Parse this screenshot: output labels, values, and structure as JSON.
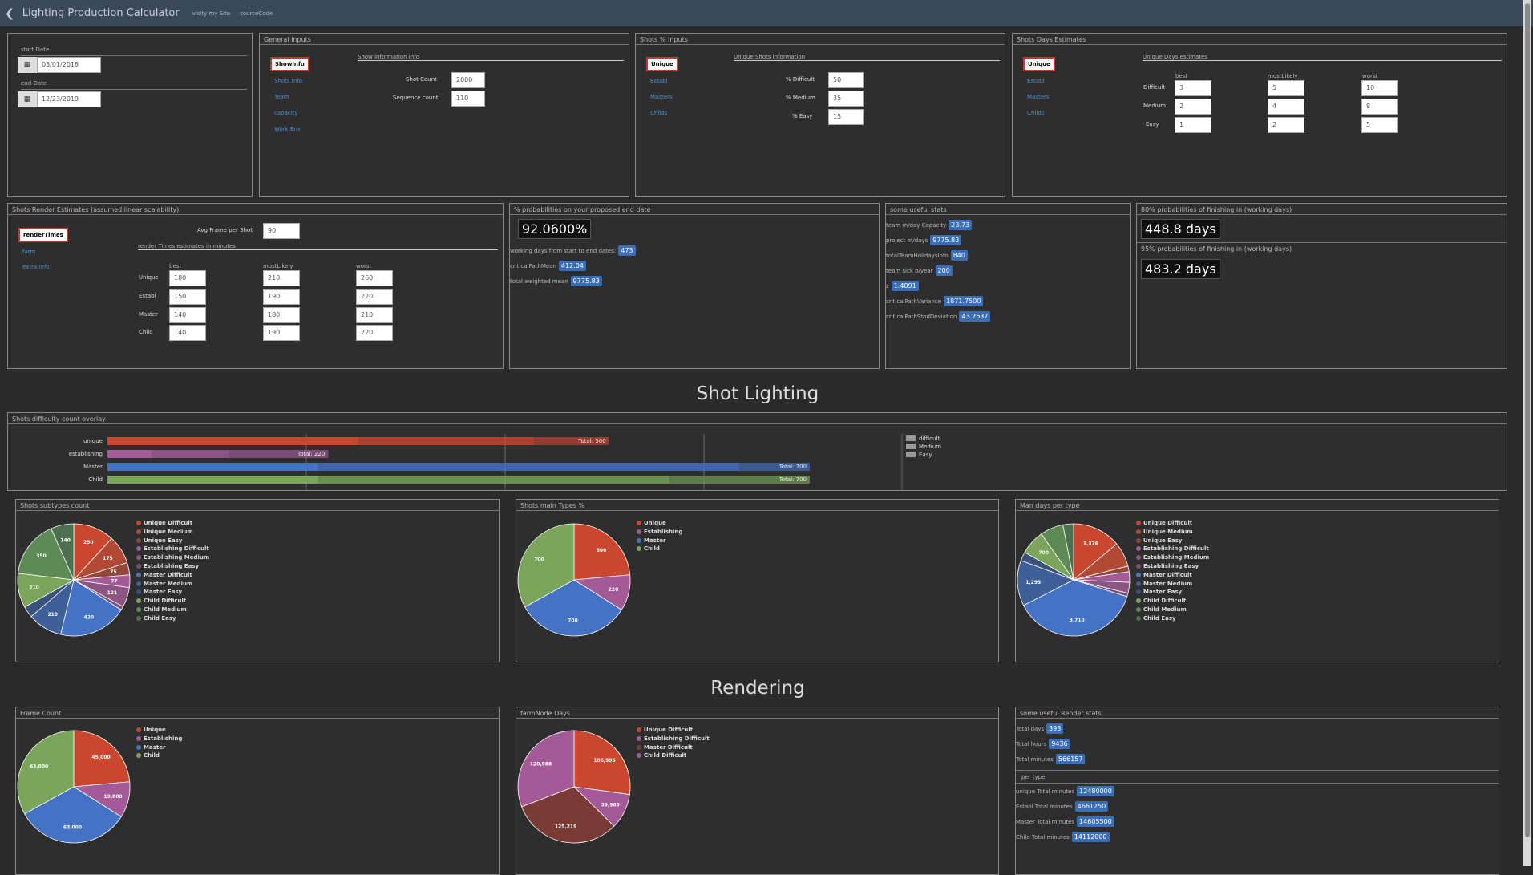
{
  "app": {
    "title": "Lighting Production Calculator",
    "link1": "visity my Site",
    "link2": "sourceCode"
  },
  "dates": {
    "start_label": "start Date",
    "start_value": "03/01/2018",
    "end_label": "end Date",
    "end_value": "12/23/2019"
  },
  "general": {
    "title": "General Inputs",
    "btn": "ShowInfo",
    "links": [
      "Shots Info",
      "Team",
      "capacity",
      "Work Env"
    ],
    "info_title": "Show information Info",
    "shot_count_label": "Shot Count",
    "shot_count": "2000",
    "seq_label": "Sequence count",
    "seq_count": "110"
  },
  "shots_pct": {
    "title": "Shots % Inputs",
    "btn": "Unique",
    "links": [
      "Establ",
      "Masters",
      "Childs"
    ],
    "info_title": "Unique Shots information",
    "rows": [
      {
        "label": "% Difficult",
        "value": "50"
      },
      {
        "label": "% Medium",
        "value": "35"
      },
      {
        "label": "% Easy",
        "value": "15"
      }
    ]
  },
  "days_est": {
    "title": "Shots Days Estimates",
    "btn": "Unique",
    "links": [
      "Establ",
      "Masters",
      "Childs"
    ],
    "info_title": "Unique Days estimates",
    "cols": [
      "best",
      "mostLikely",
      "worst"
    ],
    "rows": [
      {
        "label": "Difficult",
        "values": [
          "3",
          "5",
          "10"
        ]
      },
      {
        "label": "Medium",
        "values": [
          "2",
          "4",
          "8"
        ]
      },
      {
        "label": "Easy",
        "values": [
          "1",
          "2",
          "5"
        ]
      }
    ]
  },
  "render_est": {
    "title": "Shots Render Estimates (assumed linear scalability)",
    "btn": "renderTimes",
    "links": [
      "farm",
      "extra Info"
    ],
    "avg_label": "Avg Frame per Shot",
    "avg_value": "90",
    "sub_title": "render Times estimates in minutes",
    "cols": [
      "best",
      "mostLikely",
      "worst"
    ],
    "rows": [
      {
        "label": "Unique",
        "values": [
          "180",
          "210",
          "260"
        ]
      },
      {
        "label": "Establ",
        "values": [
          "150",
          "190",
          "220"
        ]
      },
      {
        "label": "Master",
        "values": [
          "140",
          "180",
          "210"
        ]
      },
      {
        "label": "Child",
        "values": [
          "140",
          "190",
          "220"
        ]
      }
    ]
  },
  "prob": {
    "title": "% probabilities on your proposed end date",
    "value": "92.0600%",
    "rows": [
      {
        "label": "working days from start to end dates:",
        "value": "473"
      },
      {
        "label": "criticalPathMean",
        "value": "412.04"
      },
      {
        "label": "total weighted mean",
        "value": "9775.83"
      }
    ]
  },
  "stats": {
    "title": "some useful stats",
    "rows": [
      {
        "label": "team m/day Capacity",
        "value": "23.73"
      },
      {
        "label": "project m/days",
        "value": "9775.83"
      },
      {
        "label": "totalTeamHolidaysInfo",
        "value": "840"
      },
      {
        "label": "team sick p/year",
        "value": "200"
      },
      {
        "label": "z",
        "value": "1.4091"
      },
      {
        "label": "criticalPathVariance",
        "value": "1871.7500"
      },
      {
        "label": "criticalPathStndDeviation",
        "value": "43.2637"
      }
    ]
  },
  "finish": {
    "title80": "80% probabilities of finishing in (working days)",
    "value80": "448.8 days",
    "title95": "95% probabilities of finishing in (working days)",
    "value95": "483.2 days"
  },
  "section1": "Shot Lighting",
  "section2": "Rendering",
  "overlay": {
    "title": "Shots difficulty count overlay",
    "legend": [
      "difficult",
      "Medium",
      "Easy"
    ],
    "rows": [
      {
        "label": "unique",
        "color": "#c9472f",
        "segments": [
          250,
          175,
          75
        ],
        "total": "Total: 500"
      },
      {
        "label": "establishing",
        "color": "#a55a98",
        "segments": [
          44,
          77,
          99
        ],
        "total": "Total: 220"
      },
      {
        "label": "Master",
        "color": "#4472c4",
        "segments": [
          210,
          420,
          70
        ],
        "total": "Total: 700"
      },
      {
        "label": "Child",
        "color": "#7aa55a",
        "segments": [
          210,
          350,
          140
        ],
        "total": "Total: 700"
      }
    ],
    "max": 700
  },
  "pie1": {
    "title": "Shots subtypes count",
    "legend": [
      "Unique Difficult",
      "Unique Medium",
      "Unique Easy",
      "Establishing Difficult",
      "Establishing Medium",
      "Establishing Easy",
      "Master Difficult",
      "Master Medium",
      "Master Easy",
      "Child Difficult",
      "Child Medium",
      "Child Easy"
    ],
    "colors": [
      "#c9472f",
      "#b04a35",
      "#93463a",
      "#a55a98",
      "#8d5584",
      "#7a4f72",
      "#4472c4",
      "#3e5f98",
      "#3a517a",
      "#7aa55a",
      "#5e8a55",
      "#4d7050"
    ],
    "values": [
      250,
      175,
      75,
      77,
      121,
      22,
      420,
      210,
      70,
      210,
      350,
      140
    ],
    "labels": [
      "250",
      "175",
      "75",
      "77",
      "121",
      "",
      "420",
      "210",
      "",
      "210",
      "350",
      "140"
    ]
  },
  "pie2": {
    "title": "Shots main Types %",
    "legend": [
      "Unique",
      "Establishing",
      "Master",
      "Child"
    ],
    "colors": [
      "#c9472f",
      "#a55a98",
      "#4472c4",
      "#7aa55a"
    ],
    "values": [
      500,
      220,
      700,
      700
    ],
    "labels": [
      "500",
      "220",
      "700",
      "700"
    ]
  },
  "pie3": {
    "title": "Man days per type",
    "legend": [
      "Unique Difficult",
      "Unique Medium",
      "Unique Easy",
      "Establishing Difficult",
      "Establishing Medium",
      "Establishing Easy",
      "Master Difficult",
      "Master Medium",
      "Master Easy",
      "Child Difficult",
      "Child Medium",
      "Child Easy"
    ],
    "colors": [
      "#c9472f",
      "#b04a35",
      "#93463a",
      "#a55a98",
      "#8d5584",
      "#7a4f72",
      "#4472c4",
      "#3e5f98",
      "#3a517a",
      "#7aa55a",
      "#5e8a55",
      "#4d7050"
    ],
    "values": [
      1376,
      700,
      160,
      300,
      308,
      100,
      3710,
      1295,
      250,
      700,
      660,
      300
    ],
    "labels": [
      "1,376",
      "",
      "",
      "",
      "",
      "",
      "3,710",
      "1,295",
      "",
      "700",
      "",
      ""
    ]
  },
  "pie4": {
    "title": "Frame Count",
    "legend": [
      "Unique",
      "Establishing",
      "Master",
      "Child"
    ],
    "colors": [
      "#c9472f",
      "#a55a98",
      "#4472c4",
      "#7aa55a"
    ],
    "values": [
      45000,
      19800,
      63000,
      63000
    ],
    "labels": [
      "45,000",
      "19,800",
      "63,000",
      "63,000"
    ]
  },
  "pie5": {
    "title": "farmNode Days",
    "legend": [
      "Unique Difficult",
      "Establishing Difficult",
      "Master Difficult",
      "Child Difficult"
    ],
    "colors": [
      "#c9472f",
      "#a55a98",
      "#7a3a36",
      "#a55a98"
    ],
    "values": [
      106996,
      39963,
      125219,
      120988
    ],
    "labels": [
      "106,996",
      "39,963",
      "125,219",
      "120,988"
    ]
  },
  "render_stats": {
    "title": "some useful Render stats",
    "rows": [
      {
        "label": "Total days",
        "value": "393"
      },
      {
        "label": "Total hours",
        "value": "9436"
      },
      {
        "label": "Total minutes",
        "value": "566157"
      }
    ],
    "per_type": "per type",
    "type_rows": [
      {
        "label": "unique Total minutes",
        "value": "12480000"
      },
      {
        "label": "Establ Total minutes",
        "value": "4661250"
      },
      {
        "label": "Master Total minutes",
        "value": "14605500"
      },
      {
        "label": "Child Total minutes",
        "value": "14112000"
      }
    ]
  }
}
